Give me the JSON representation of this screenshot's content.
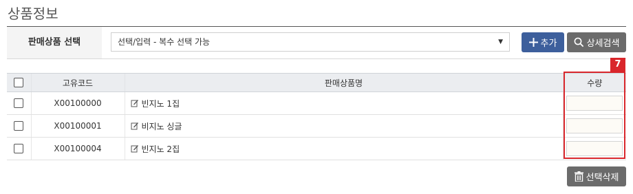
{
  "page": {
    "title": "상품정보"
  },
  "product_select": {
    "label": "판매상품 선택",
    "value": "선택/입력 - 복수 선택 가능",
    "caret": "▼"
  },
  "buttons": {
    "add": "추가",
    "detail_search": "상세검색",
    "delete_selected": "선택삭제"
  },
  "table": {
    "headers": {
      "code": "고유코드",
      "name": "판매상품명",
      "qty": "수량"
    },
    "rows": [
      {
        "code": "X00100000",
        "name": "빈지노 1집"
      },
      {
        "code": "X00100001",
        "name": "비지노 싱글"
      },
      {
        "code": "X00100004",
        "name": "빈지노 2집"
      }
    ]
  },
  "annotation": {
    "step": "7",
    "color": "#d9262b"
  },
  "colors": {
    "primary_button": "#3d5f9c",
    "secondary_button": "#6b6b6b",
    "header_bg": "#ebedf0"
  }
}
